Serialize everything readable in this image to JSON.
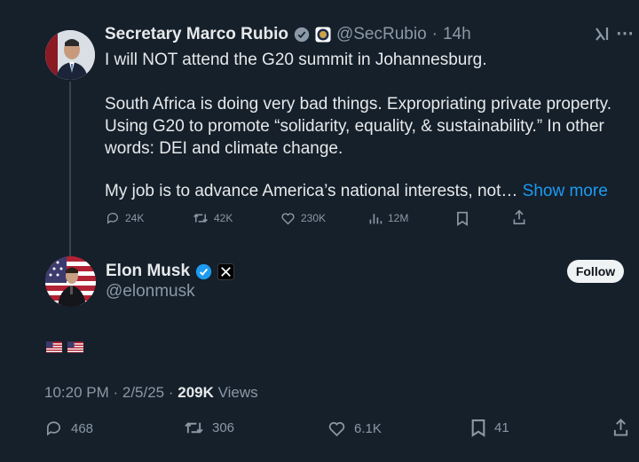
{
  "quoted": {
    "name": "Secretary Marco Rubio",
    "handle": "@SecRubio",
    "separator": "·",
    "time": "14h",
    "line1": "I will NOT attend the G20 summit in Johannesburg.",
    "line2": "South Africa is doing very bad things. Expropriating private property. Using G20 to promote “solidarity, equality, & sustainability.” In other words: DEI and climate change.",
    "line3": "My job is to advance America’s national interests, not…",
    "show_more": "Show more",
    "replies": "24K",
    "reposts": "42K",
    "likes": "230K",
    "views": "12M"
  },
  "post": {
    "name": "Elon Musk",
    "handle": "@elonmusk",
    "follow_label": "Follow",
    "timestamp": "10:20 PM · 2/5/25 · ",
    "views_count": "209K",
    "views_label": " Views",
    "replies": "468",
    "reposts": "306",
    "likes": "6.1K",
    "bookmarks": "41"
  },
  "colors": {
    "background": "#15202b",
    "accent": "#1d9bf0",
    "muted": "#8b98a5",
    "verified": "#1d9bf0"
  },
  "icons": [
    "verified-badge-icon",
    "grok-icon",
    "reply-icon",
    "repost-icon",
    "like-icon",
    "views-icon",
    "bookmark-icon",
    "share-icon",
    "x-logo-icon",
    "us-flag-icon"
  ]
}
